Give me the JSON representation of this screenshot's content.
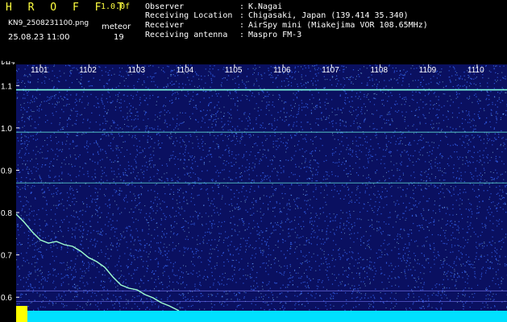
{
  "header": {
    "app_title": "H R O F F T",
    "app_version": "1.0.0f",
    "file_name": "KN9_2508231100.png",
    "mode": "meteor",
    "datetime": "25.08.23 11:00",
    "count": "19",
    "info": [
      {
        "label": "Observer",
        "sep": ":",
        "value": "K.Nagai"
      },
      {
        "label": "Receiving Location",
        "sep": ":",
        "value": "Chigasaki, Japan (139.414 35.340)"
      },
      {
        "label": "Receiver",
        "sep": ":",
        "value": "AirSpy mini (Miakejima VOR 108.65MHz)"
      },
      {
        "label": "Receiving antenna",
        "sep": ":",
        "value": "Maspro FM-3"
      }
    ]
  },
  "chart_data": {
    "type": "heatmap",
    "ylabel": "kHz",
    "y_ticks": [
      "1.1",
      "1.0",
      "0.9",
      "0.8",
      "0.7",
      "0.6"
    ],
    "x_ticks": [
      "1101",
      "1102",
      "1103",
      "1104",
      "1105",
      "1106",
      "1107",
      "1108",
      "1109",
      "1110"
    ],
    "ylim": [
      0.57,
      1.15
    ],
    "xlim": [
      1100.5,
      1110.5
    ],
    "carrier_lines_khz": [
      1.09,
      0.99,
      0.87
    ],
    "colors": {
      "background": "#0a1060",
      "noise": "#3a6cff",
      "signal": "#a0ffd0",
      "bottom_bar": "#00e0ff",
      "marker": "#ffff00"
    }
  }
}
